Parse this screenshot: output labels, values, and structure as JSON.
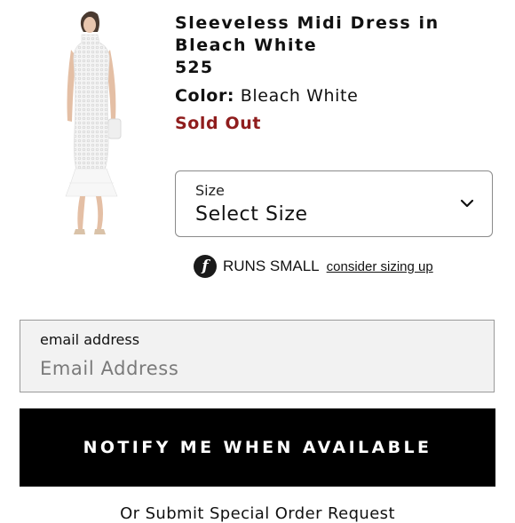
{
  "product": {
    "title": "Sleeveless Midi Dress in Bleach White",
    "price": "525",
    "color_label": "Color:",
    "color_value": "Bleach White",
    "availability": "Sold Out"
  },
  "size_select": {
    "label": "Size",
    "value": "Select Size"
  },
  "fit_note": {
    "icon_glyph": "f",
    "text": "RUNS SMALL",
    "link": "consider sizing up"
  },
  "email_field": {
    "label": "email address",
    "placeholder": "Email Address"
  },
  "notify_button": {
    "label": "NOTIFY ME WHEN AVAILABLE"
  },
  "special_order": {
    "text": "Or Submit Special Order Request"
  },
  "colors": {
    "sold_out": "#8f1d1d",
    "button_bg": "#000000",
    "input_bg": "#f2f2f2"
  }
}
